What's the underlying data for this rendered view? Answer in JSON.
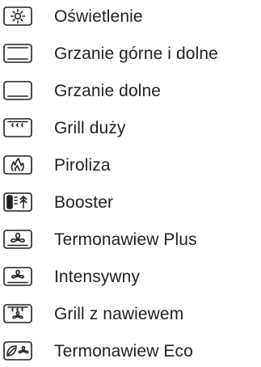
{
  "colors": {
    "text": "#231f20",
    "icon_stroke": "#231f20",
    "background": "#ffffff"
  },
  "functions": [
    {
      "icon": "light-icon",
      "label": "Oświetlenie"
    },
    {
      "icon": "top-bottom-heat-icon",
      "label": "Grzanie górne i dolne"
    },
    {
      "icon": "bottom-heat-icon",
      "label": "Grzanie dolne"
    },
    {
      "icon": "grill-large-icon",
      "label": "Grill duży"
    },
    {
      "icon": "pyrolysis-icon",
      "label": "Piroliza"
    },
    {
      "icon": "booster-icon",
      "label": "Booster"
    },
    {
      "icon": "fan-plus-icon",
      "label": "Termonawiew Plus"
    },
    {
      "icon": "intensive-fan-icon",
      "label": "Intensywny"
    },
    {
      "icon": "fan-grill-icon",
      "label": "Grill z nawiewem"
    },
    {
      "icon": "fan-eco-icon",
      "label": "Termonawiew Eco"
    }
  ]
}
